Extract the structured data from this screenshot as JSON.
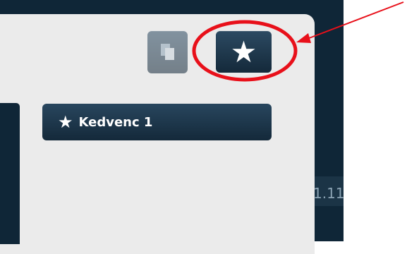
{
  "background": {
    "fragment_text": "1.11"
  },
  "toolbar": {
    "copy_icon": "copy-icon",
    "favorite_star": "★"
  },
  "favorites": {
    "items": [
      {
        "star": "★",
        "label": "Kedvenc 1"
      }
    ]
  },
  "annotation": {
    "color": "#e8101a"
  }
}
